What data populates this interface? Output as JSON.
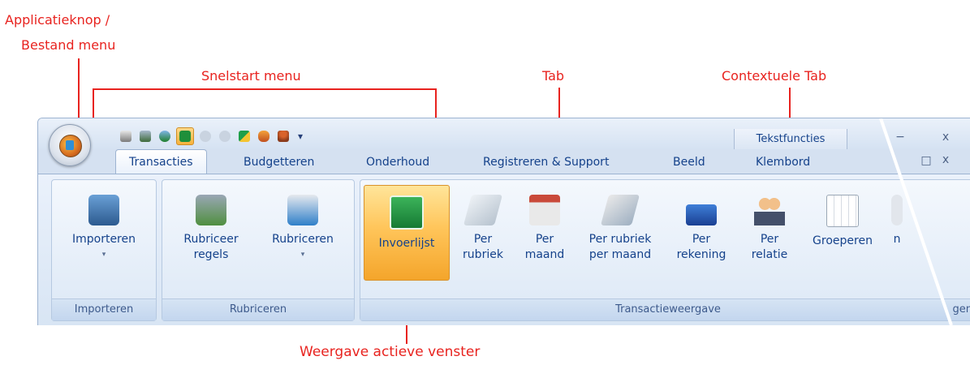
{
  "annotations": {
    "app_button": [
      "Applicatieknop /",
      "Bestand menu"
    ],
    "quick_access": "Snelstart menu",
    "tab": "Tab",
    "contextual_tab": "Contextuele Tab",
    "active_view": "Weergave actieve venster"
  },
  "titlebar": {
    "contextual_tab_label": "Tekstfuncties",
    "minimize_glyph": "−",
    "close_glyph": "x",
    "mdi_restore_glyph": "□",
    "mdi_close_glyph": "x"
  },
  "quick_access": {
    "icons": [
      "printer-icon",
      "trash-icon",
      "refresh-icon",
      "euro-list-icon",
      "back-icon",
      "forward-icon",
      "bookmark-icon",
      "glasses-icon",
      "joystick-icon"
    ],
    "selected_index": 3,
    "dropdown_glyph": "▾"
  },
  "tabs": [
    {
      "label": "Transacties",
      "active": true
    },
    {
      "label": "Budgetteren",
      "active": false
    },
    {
      "label": "Onderhoud",
      "active": false
    },
    {
      "label": "Registreren & Support",
      "active": false
    },
    {
      "label": "Beeld",
      "active": false
    },
    {
      "label": "Klembord",
      "active": false
    }
  ],
  "groups": {
    "importeren": {
      "label": "Importeren",
      "buttons": [
        {
          "label": "Importeren",
          "caret": "▾",
          "icon": "import-bin-icon"
        }
      ]
    },
    "rubriceren": {
      "label": "Rubriceren",
      "buttons": [
        {
          "label": "Rubriceer\nregels",
          "icon": "rules-icon"
        },
        {
          "label": "Rubriceren",
          "caret": "▾",
          "icon": "categorize-icon"
        }
      ]
    },
    "transactieweergave": {
      "label": "Transactieweergave",
      "label_tail": "gen",
      "buttons": [
        {
          "label": "Invoerlijst",
          "icon": "euro-list-icon",
          "active": true
        },
        {
          "label": "Per\nrubriek",
          "icon": "folder-chart-icon"
        },
        {
          "label": "Per\nmaand",
          "icon": "calendar-icon"
        },
        {
          "label": "Per rubriek\nper maand",
          "icon": "calendar-chart-icon"
        },
        {
          "label": "Per\nrekening",
          "icon": "card-icon"
        },
        {
          "label": "Per\nrelatie",
          "icon": "people-icon"
        },
        {
          "label": "Groeperen",
          "icon": "grid-icon"
        },
        {
          "label": "n",
          "icon": "partial-icon"
        }
      ]
    }
  },
  "colors": {
    "annotation": "#e8231f",
    "tab_text": "#15428b",
    "active_button": "#ffc55a"
  }
}
